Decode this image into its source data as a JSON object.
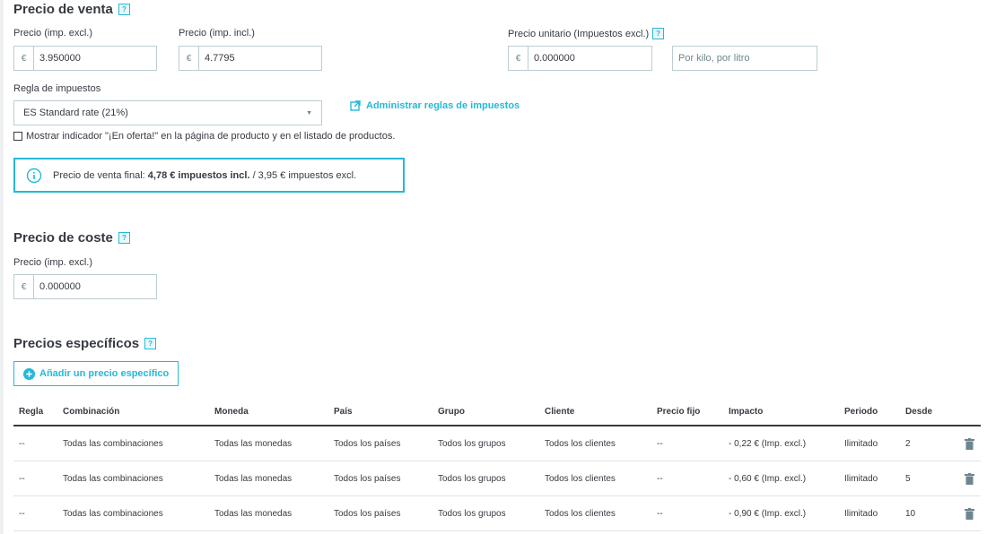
{
  "sale_price": {
    "title": "Precio de venta",
    "help": "?",
    "price_excl_label": "Precio (imp. excl.)",
    "price_excl_currency": "€",
    "price_excl_value": "3.950000",
    "price_incl_label": "Precio (imp. incl.)",
    "price_incl_currency": "€",
    "price_incl_value": "4.7795",
    "unit_price_label": "Precio unitario (Impuestos excl.)",
    "unit_price_help": "?",
    "unit_price_currency": "€",
    "unit_price_value": "0.000000",
    "unit_placeholder": "Por kilo, por litro",
    "tax_rule_label": "Regla de impuestos",
    "tax_rule_value": "ES Standard rate (21%)",
    "manage_tax_link": "Administrar reglas de impuestos",
    "on_sale_checkbox": "Mostrar indicador \"¡En oferta!\" en la página de producto y en el listado de productos.",
    "on_sale_checked": false,
    "final_price_prefix": "Precio de venta final: ",
    "final_price_bold": "4,78 € impuestos incl.",
    "final_price_suffix": " / 3,95 € impuestos excl."
  },
  "cost_price": {
    "title": "Precio de coste",
    "help": "?",
    "price_label": "Precio (imp. excl.)",
    "currency": "€",
    "value": "0.000000"
  },
  "specific_prices": {
    "title": "Precios específicos",
    "help": "?",
    "add_button": "Añadir un precio específico",
    "columns": [
      "Regla",
      "Combinación",
      "Moneda",
      "País",
      "Grupo",
      "Cliente",
      "Precio fijo",
      "Impacto",
      "Periodo",
      "Desde"
    ],
    "rows": [
      [
        "--",
        "Todas las combinaciones",
        "Todas las monedas",
        "Todos los países",
        "Todos los grupos",
        "Todos los clientes",
        "--",
        "- 0,22 € (Imp. excl.)",
        "Ilimitado",
        "2"
      ],
      [
        "--",
        "Todas las combinaciones",
        "Todas las monedas",
        "Todos los países",
        "Todos los grupos",
        "Todos los clientes",
        "--",
        "- 0,60 € (Imp. excl.)",
        "Ilimitado",
        "5"
      ],
      [
        "--",
        "Todas las combinaciones",
        "Todas las monedas",
        "Todos los países",
        "Todos los grupos",
        "Todos los clientes",
        "--",
        "- 0,90 € (Imp. excl.)",
        "Ilimitado",
        "10"
      ]
    ]
  },
  "colors": {
    "accent": "#25b9d7",
    "text": "#363a41",
    "border": "#bbcdd2"
  },
  "icons": {
    "help": "question-badge-icon",
    "external_link": "external-link-icon",
    "info": "info-circle-icon",
    "add": "plus-circle-icon",
    "delete": "trash-icon"
  }
}
